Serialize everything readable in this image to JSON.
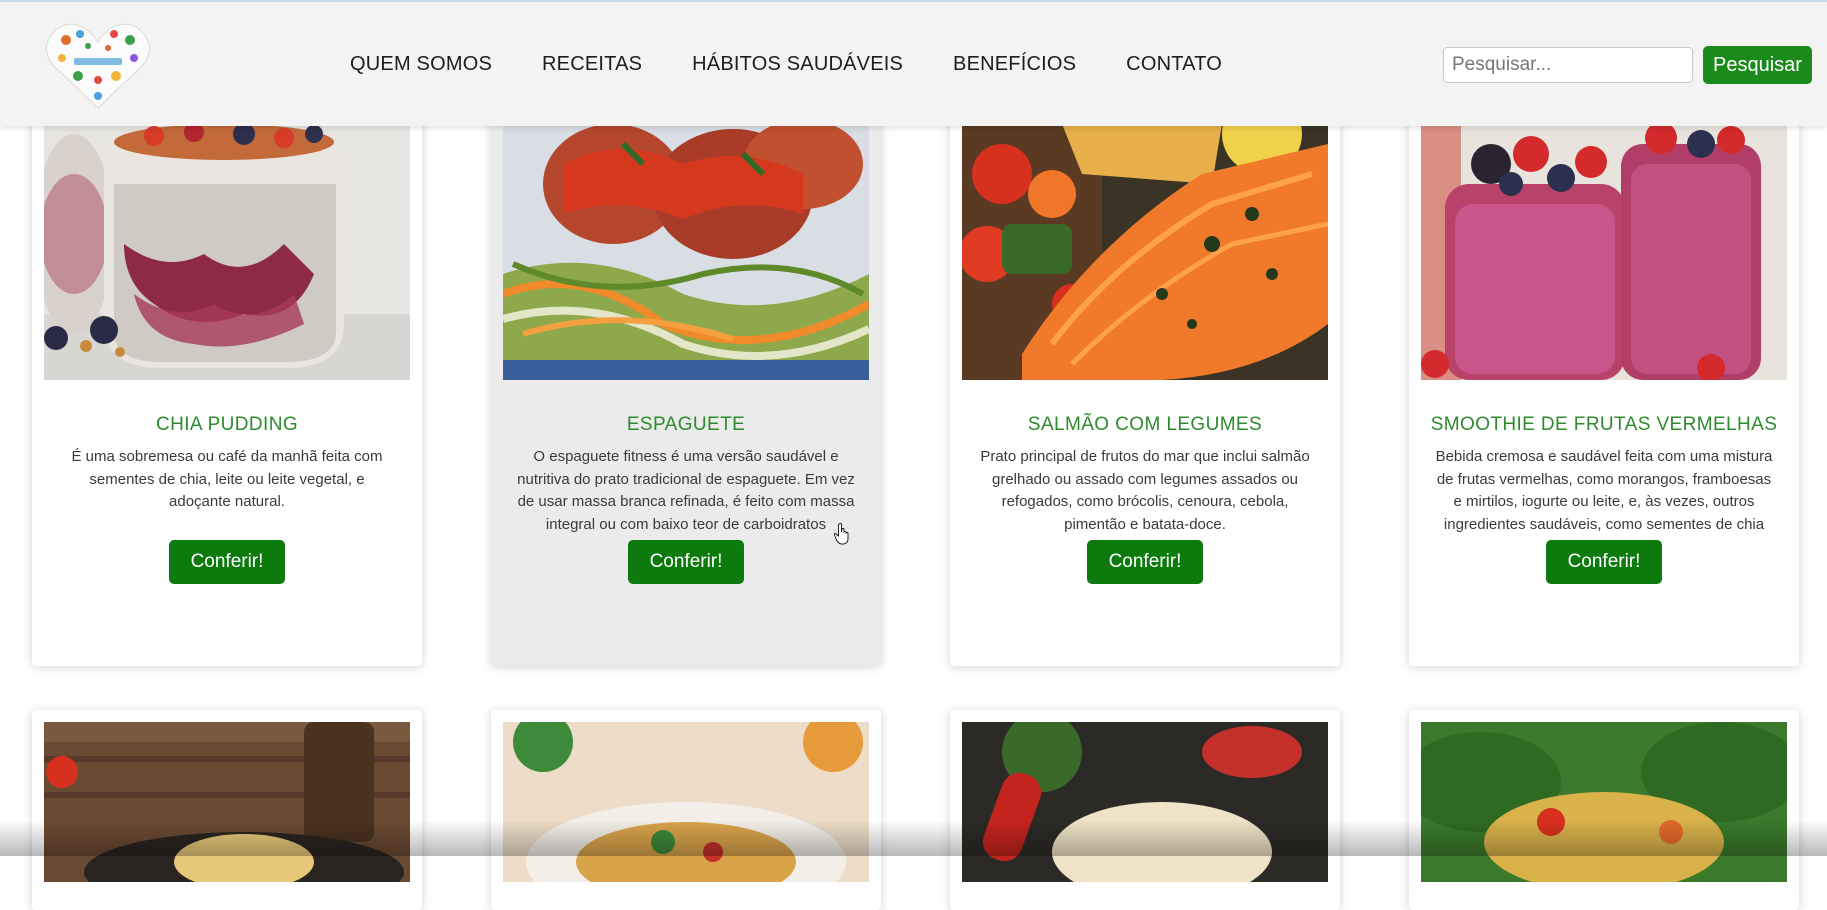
{
  "header": {
    "logo_name": "healthy-lifestyle-heart-logo",
    "nav": [
      "QUEM SOMOS",
      "RECEITAS",
      "HÁBITOS SAUDÁVEIS",
      "BENEFÍCIOS",
      "CONTATO"
    ],
    "search": {
      "placeholder": "Pesquisar...",
      "button": "Pesquisar"
    }
  },
  "colors": {
    "accent": "#0c7a0c",
    "title": "#2d8a2d",
    "header_bg": "#f3f3f3"
  },
  "cards": [
    {
      "title": "CHIA PUDDING",
      "description": "É uma sobremesa ou café da manhã feita com sementes de chia, leite ou leite vegetal, e adoçante natural.",
      "button": "Conferir!"
    },
    {
      "title": "ESPAGUETE",
      "description": "O espaguete fitness é uma versão saudável e nutritiva do prato tradicional de espaguete. Em vez de usar massa branca refinada, é feito com massa integral ou com baixo teor de carboidratos",
      "button": "Conferir!"
    },
    {
      "title": "SALMÃO COM LEGUMES",
      "description": "Prato principal de frutos do mar que inclui salmão grelhado ou assado com legumes assados ou refogados, como brócolis, cenoura, cebola, pimentão e batata-doce.",
      "button": "Conferir!"
    },
    {
      "title": "SMOOTHIE DE FRUTAS VERMELHAS",
      "description": "Bebida cremosa e saudável feita com uma mistura de frutas vermelhas, como morangos, framboesas e mirtilos, iogurte ou leite, e, às vezes, outros ingredientes saudáveis, como sementes de chia ou aveia.",
      "button": "Conferir!"
    }
  ]
}
